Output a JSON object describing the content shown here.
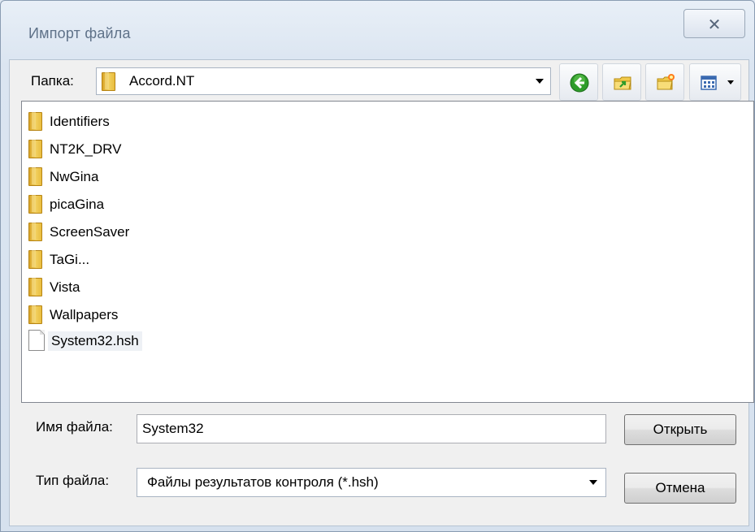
{
  "window": {
    "title": "Импорт файла",
    "close_glyph": "✕"
  },
  "toolbar": {
    "folder_label": "Папка:",
    "folder_value": "Accord.NT",
    "back_icon": "back-arrow-icon",
    "up_icon": "folder-up-icon",
    "new_folder_icon": "new-folder-icon",
    "view_icon": "view-menu-icon"
  },
  "files": [
    {
      "name": "Identifiers",
      "type": "folder"
    },
    {
      "name": "NT2K_DRV",
      "type": "folder"
    },
    {
      "name": "NwGina",
      "type": "folder"
    },
    {
      "name": "picaGina",
      "type": "folder"
    },
    {
      "name": "ScreenSaver",
      "type": "folder"
    },
    {
      "name": "TaGi...",
      "type": "folder"
    },
    {
      "name": "Vista",
      "type": "folder"
    },
    {
      "name": "Wallpapers",
      "type": "folder"
    },
    {
      "name": "System32.hsh",
      "type": "file"
    }
  ],
  "form": {
    "filename_label": "Имя файла:",
    "filename_value": "System32",
    "filetype_label": "Тип файла:",
    "filetype_value": "Файлы результатов контроля (*.hsh)",
    "open_button": "Открыть",
    "cancel_button": "Отмена"
  },
  "colors": {
    "accent_green": "#2e9c2a",
    "folder_yellow": "#e9bd3e"
  }
}
